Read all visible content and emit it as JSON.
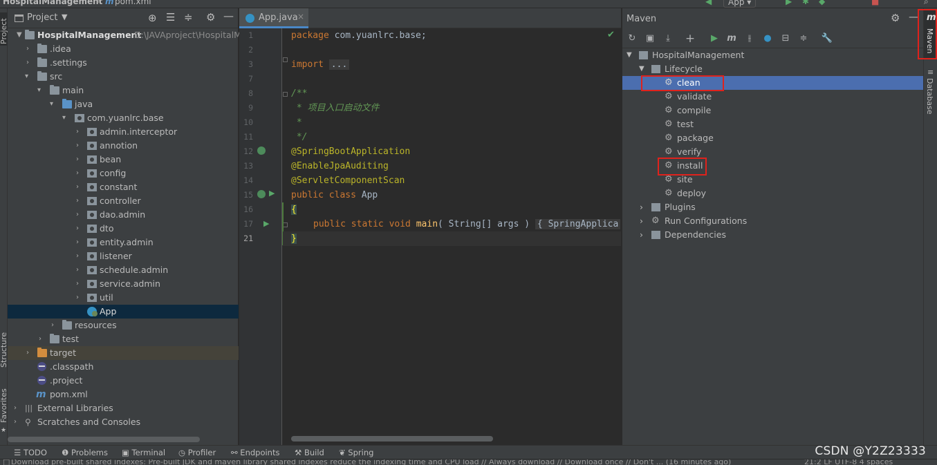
{
  "topbar": {
    "project_name": "HospitalManagement",
    "file_name": "pom.xml",
    "run_config": "App"
  },
  "project_panel": {
    "title": "Project",
    "root": {
      "name": "HospitalManagement",
      "path": "D:\\JAVAproject\\HospitalM"
    },
    "tree": [
      {
        "label": ".idea"
      },
      {
        "label": ".settings"
      },
      {
        "label": "src"
      },
      {
        "label": "main"
      },
      {
        "label": "java"
      },
      {
        "label": "com.yuanlrc.base"
      },
      {
        "label": "admin.interceptor"
      },
      {
        "label": "annotion"
      },
      {
        "label": "bean"
      },
      {
        "label": "config"
      },
      {
        "label": "constant"
      },
      {
        "label": "controller"
      },
      {
        "label": "dao.admin"
      },
      {
        "label": "dto"
      },
      {
        "label": "entity.admin"
      },
      {
        "label": "listener"
      },
      {
        "label": "schedule.admin"
      },
      {
        "label": "service.admin"
      },
      {
        "label": "util"
      },
      {
        "label": "App"
      },
      {
        "label": "resources"
      },
      {
        "label": "test"
      },
      {
        "label": "target"
      },
      {
        "label": ".classpath"
      },
      {
        "label": ".project"
      },
      {
        "label": "pom.xml"
      },
      {
        "label": "External Libraries"
      },
      {
        "label": "Scratches and Consoles"
      }
    ]
  },
  "left_strip": {
    "project": "Project",
    "structure": "Structure",
    "favorites": "Favorites"
  },
  "editor": {
    "tab": "App.java",
    "lines": [
      {
        "num": "1"
      },
      {
        "num": "2"
      },
      {
        "num": "3"
      },
      {
        "num": "7"
      },
      {
        "num": "8"
      },
      {
        "num": "9"
      },
      {
        "num": "10"
      },
      {
        "num": "11"
      },
      {
        "num": "12"
      },
      {
        "num": "13"
      },
      {
        "num": "14"
      },
      {
        "num": "15"
      },
      {
        "num": "16"
      },
      {
        "num": "17"
      },
      {
        "num": "21"
      }
    ],
    "code": {
      "package_kw": "package",
      "package_name": " com.yuanlrc.base;",
      "import_kw": "import",
      "import_fold": "...",
      "doc_open": "/**",
      "doc_line": " * 项目入口启动文件",
      "doc_star": " *",
      "doc_close": " */",
      "ann1": "@SpringBootApplication",
      "ann2": "@EnableJpaAuditing",
      "ann3": "@ServletComponentScan",
      "class_kw": "public class",
      "class_name": " App",
      "brace_open": "{",
      "main_kw": "public static void",
      "main_fn": "main",
      "main_args": "( String[] args ) ",
      "main_fold": "{ SpringApplica",
      "brace_close": "}"
    }
  },
  "maven_panel": {
    "title": "Maven",
    "root": "HospitalManagement",
    "lifecycle": "Lifecycle",
    "goals": [
      "clean",
      "validate",
      "compile",
      "test",
      "package",
      "verify",
      "install",
      "site",
      "deploy"
    ],
    "selected_goal": "clean",
    "highlighted_goals": [
      "clean",
      "install"
    ],
    "others": [
      "Plugins",
      "Run Configurations",
      "Dependencies"
    ]
  },
  "right_strip": {
    "maven": "Maven",
    "database": "Database"
  },
  "bottom_tools": [
    "TODO",
    "Problems",
    "Terminal",
    "Profiler",
    "Endpoints",
    "Build",
    "Spring"
  ],
  "status": {
    "message": "Download pre-built shared indexes: Pre-built JDK and maven library shared indexes reduce the indexing time and CPU load // Always download // Download once // Don't ... (16 minutes ago)",
    "right": "21:2   LF   UTF-8   4 spaces"
  },
  "watermark": "CSDN @Y2Z23333",
  "colors": {
    "accent": "#4b6eaf",
    "highlight_box": "#e0221c",
    "selected_row": "#0d293e"
  }
}
